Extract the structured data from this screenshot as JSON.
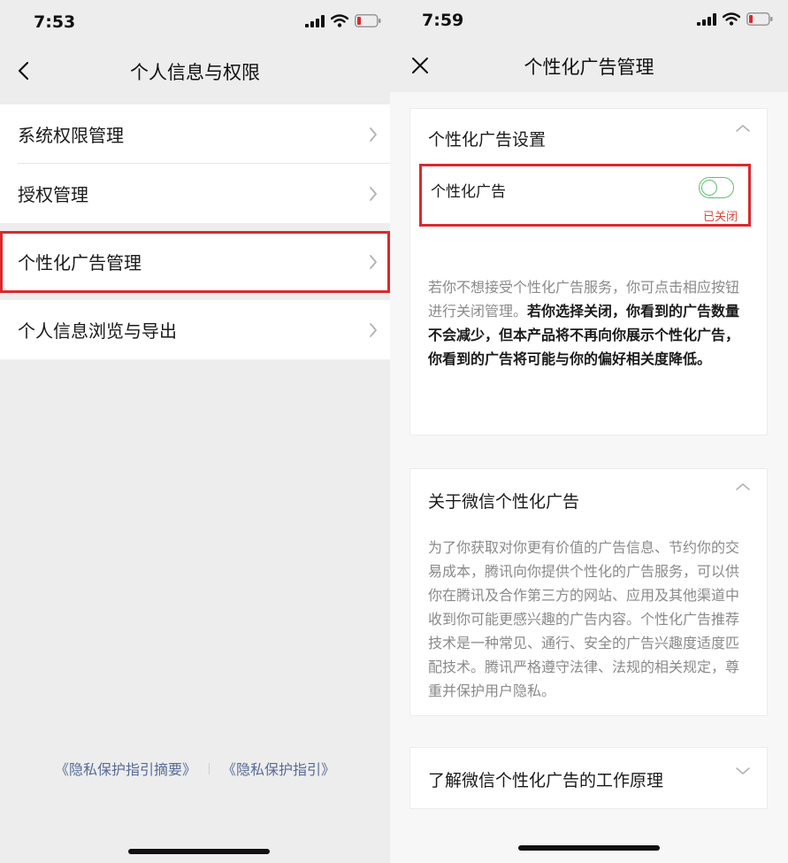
{
  "left_screen": {
    "status_time": "7:53",
    "title": "个人信息与权限",
    "group1": [
      {
        "label": "系统权限管理"
      },
      {
        "label": "授权管理"
      }
    ],
    "group2": [
      {
        "label": "个性化广告管理"
      }
    ],
    "group3": [
      {
        "label": "个人信息浏览与导出"
      }
    ],
    "footer": {
      "link1": "《隐私保护指引摘要》",
      "link2": "《隐私保护指引》"
    }
  },
  "right_screen": {
    "status_time": "7:59",
    "title": "个性化广告管理",
    "settings_card": {
      "title": "个性化广告设置",
      "toggle_label": "个性化广告",
      "toggle_status": "已关闭",
      "toggle_on": false,
      "desc_plain": "若你不想接受个性化广告服务，你可点击相应按钮进行关闭管理。",
      "desc_bold": "若你选择关闭，你看到的广告数量不会减少，但本产品将不再向你展示个性化广告，你看到的广告将可能与你的偏好相关度降低。"
    },
    "about_card": {
      "title": "关于微信个性化广告",
      "body": "为了你获取对你更有价值的广告信息、节约你的交易成本，腾讯向你提供个性化的广告服务，可以供你在腾讯及合作第三方的网站、应用及其他渠道中收到你可能更感兴趣的广告内容。个性化广告推荐技术是一种常见、通行、安全的广告兴趣度适度匹配技术。腾讯严格遵守法律、法规的相关规定，尊重并保护用户隐私。"
    },
    "how_card": {
      "title": "了解微信个性化广告的工作原理"
    }
  },
  "colors": {
    "highlight": "#d82a2f",
    "link": "#576b95",
    "toggle": "#5fbf6d",
    "status_off": "#d8493f"
  }
}
